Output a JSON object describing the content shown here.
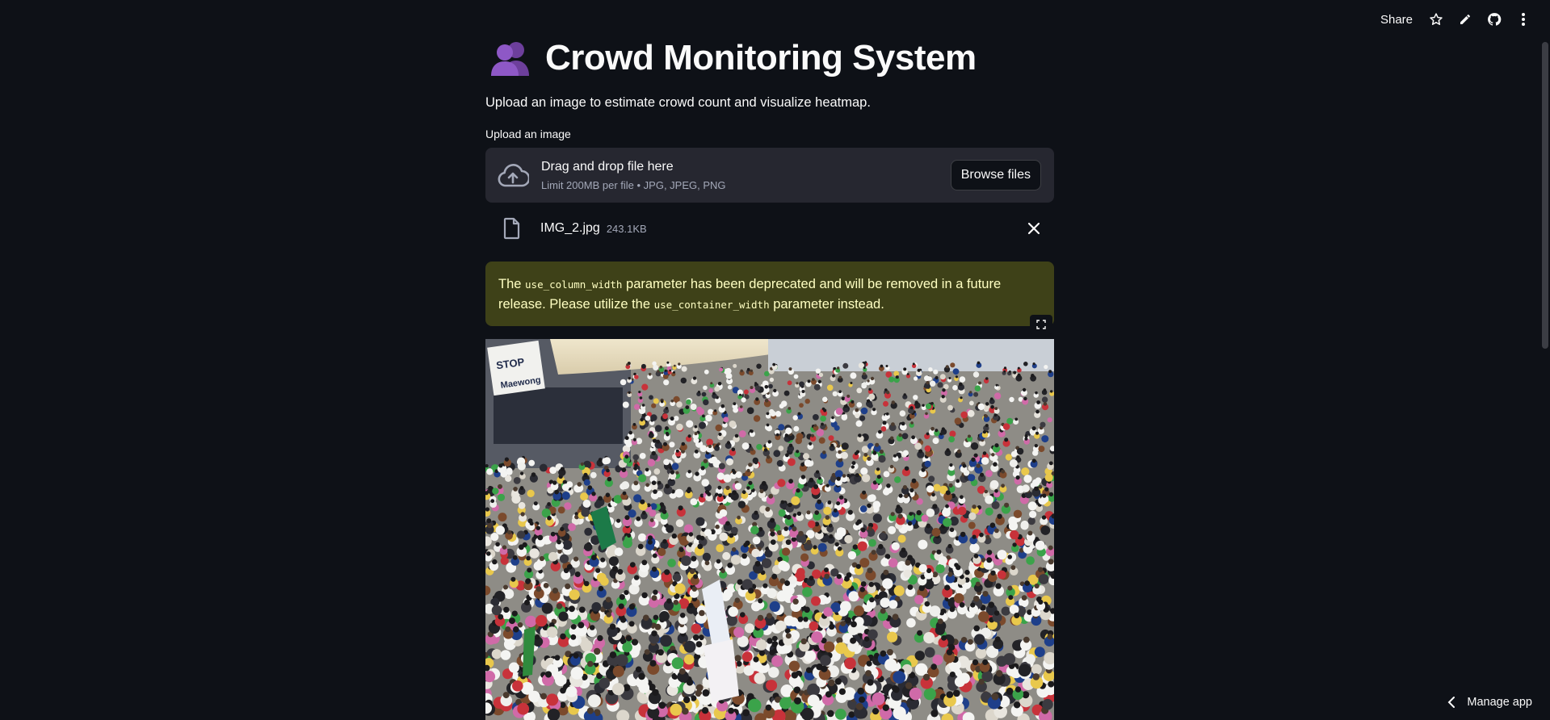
{
  "toolbar": {
    "share_label": "Share",
    "icons": [
      "star-icon",
      "pencil-icon",
      "github-icon",
      "more-vertical-icon"
    ]
  },
  "header": {
    "emoji_icon": "people-silhouette-icon",
    "title": "Crowd Monitoring System",
    "subtitle": "Upload an image to estimate crowd count and visualize heatmap."
  },
  "uploader": {
    "label": "Upload an image",
    "icon": "cloud-upload-icon",
    "drop_title": "Drag and drop file here",
    "limit_text": "Limit 200MB per file • JPG, JPEG, PNG",
    "browse_label": "Browse files"
  },
  "uploaded_file": {
    "icon": "file-icon",
    "name": "IMG_2.jpg",
    "size": "243.1KB"
  },
  "warning": {
    "part1": "The ",
    "code1": "use_column_width",
    "part2": " parameter has been deprecated and will be removed in a future release. Please utilize the ",
    "code2": "use_container_width",
    "part3": " parameter instead.",
    "colors": {
      "background": "#3e4118",
      "text": "#ffffc2"
    }
  },
  "image": {
    "sign_text_1": "STOP",
    "sign_text_2": "Maewong"
  },
  "footer": {
    "manage_label": "Manage app"
  },
  "colors": {
    "background": "#0e1117",
    "surface": "#262730",
    "muted_text": "#a3a8b8"
  }
}
